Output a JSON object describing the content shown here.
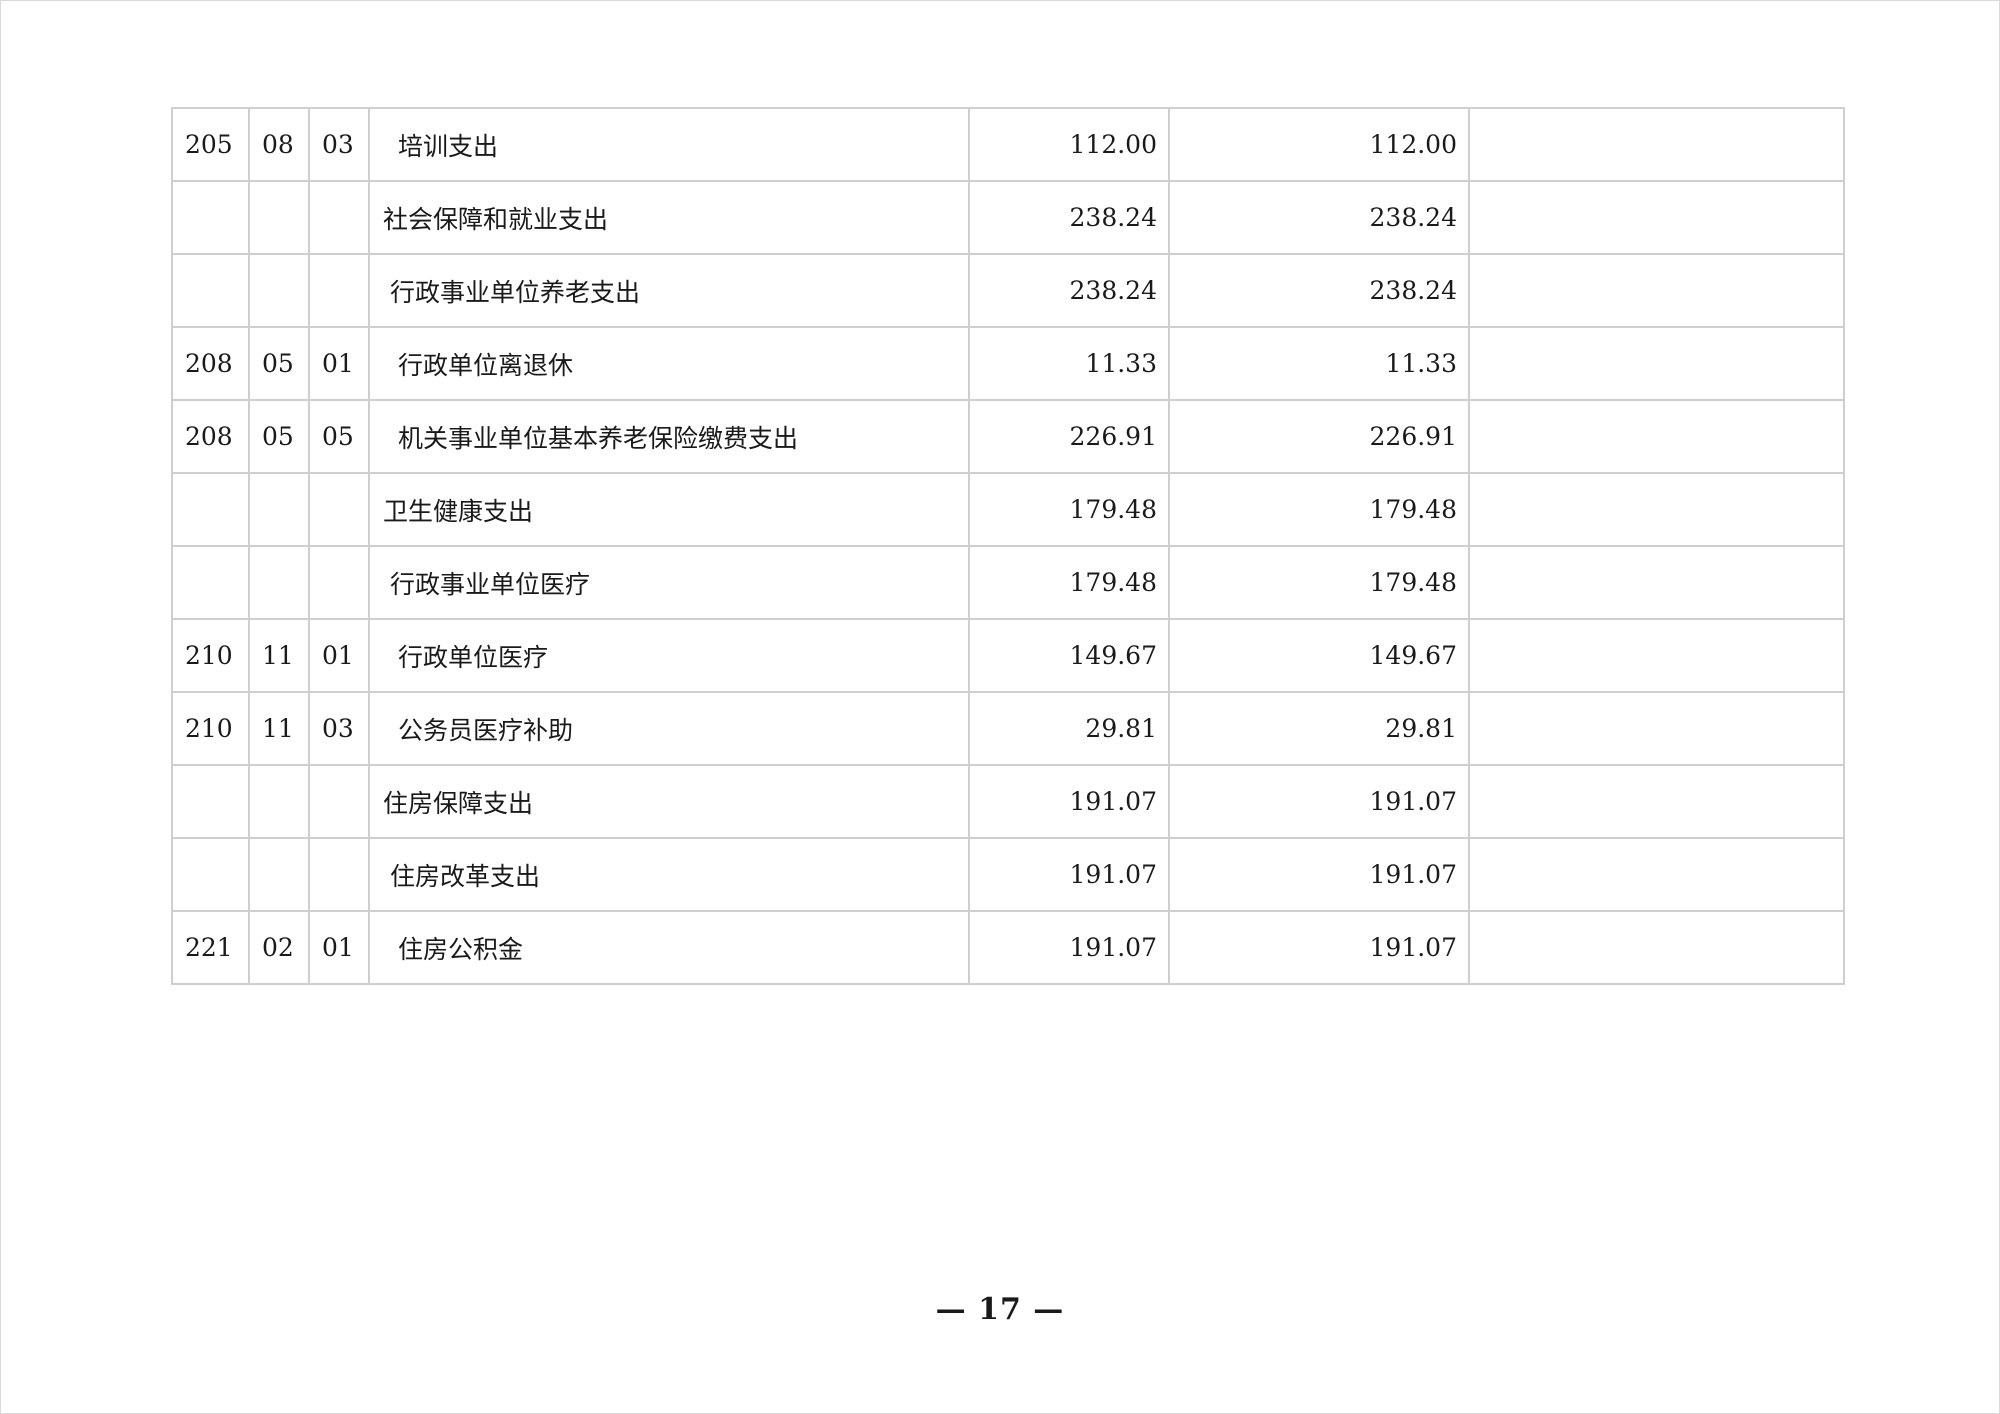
{
  "table": {
    "rows": [
      {
        "class": "205",
        "item": "08",
        "sub": "03",
        "name": "培训支出",
        "level": 3,
        "total": "112.00",
        "basic": "112.00",
        "project": ""
      },
      {
        "class": "",
        "item": "",
        "sub": "",
        "name": "社会保障和就业支出",
        "level": 1,
        "total": "238.24",
        "basic": "238.24",
        "project": ""
      },
      {
        "class": "",
        "item": "",
        "sub": "",
        "name": "行政事业单位养老支出",
        "level": 2,
        "total": "238.24",
        "basic": "238.24",
        "project": ""
      },
      {
        "class": "208",
        "item": "05",
        "sub": "01",
        "name": "行政单位离退休",
        "level": 3,
        "total": "11.33",
        "basic": "11.33",
        "project": ""
      },
      {
        "class": "208",
        "item": "05",
        "sub": "05",
        "name": "机关事业单位基本养老保险缴费支出",
        "level": 3,
        "total": "226.91",
        "basic": "226.91",
        "project": ""
      },
      {
        "class": "",
        "item": "",
        "sub": "",
        "name": "卫生健康支出",
        "level": 1,
        "total": "179.48",
        "basic": "179.48",
        "project": ""
      },
      {
        "class": "",
        "item": "",
        "sub": "",
        "name": "行政事业单位医疗",
        "level": 2,
        "total": "179.48",
        "basic": "179.48",
        "project": ""
      },
      {
        "class": "210",
        "item": "11",
        "sub": "01",
        "name": "行政单位医疗",
        "level": 3,
        "total": "149.67",
        "basic": "149.67",
        "project": ""
      },
      {
        "class": "210",
        "item": "11",
        "sub": "03",
        "name": "公务员医疗补助",
        "level": 3,
        "total": "29.81",
        "basic": "29.81",
        "project": ""
      },
      {
        "class": "",
        "item": "",
        "sub": "",
        "name": "住房保障支出",
        "level": 1,
        "total": "191.07",
        "basic": "191.07",
        "project": ""
      },
      {
        "class": "",
        "item": "",
        "sub": "",
        "name": "住房改革支出",
        "level": 2,
        "total": "191.07",
        "basic": "191.07",
        "project": ""
      },
      {
        "class": "221",
        "item": "02",
        "sub": "01",
        "name": "住房公积金",
        "level": 3,
        "total": "191.07",
        "basic": "191.07",
        "project": ""
      }
    ]
  },
  "footer": {
    "page_number": "— 17 —"
  }
}
